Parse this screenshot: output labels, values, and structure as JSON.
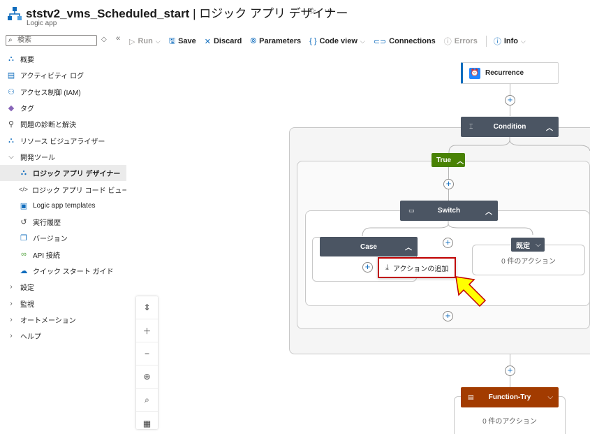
{
  "header": {
    "title": "ststv2_vms_Scheduled_start",
    "title_suffix": "| ロジック アプリ デザイナー",
    "subtitle": "Logic app",
    "star_icon": "☆",
    "more_icon": "···"
  },
  "toolbar": {
    "run": "Run",
    "save": "Save",
    "discard": "Discard",
    "parameters": "Parameters",
    "code_view": "Code view",
    "connections": "Connections",
    "errors": "Errors",
    "info": "Info"
  },
  "sidebar": {
    "search_placeholder": "検索",
    "items": [
      {
        "label": "概要",
        "icon": "overview-icon"
      },
      {
        "label": "アクティビティ ログ",
        "icon": "activity-log-icon"
      },
      {
        "label": "アクセス制御 (IAM)",
        "icon": "iam-icon"
      },
      {
        "label": "タグ",
        "icon": "tag-icon"
      },
      {
        "label": "問題の診断と解決",
        "icon": "wrench-icon"
      },
      {
        "label": "リソース ビジュアライザー",
        "icon": "visualizer-icon"
      },
      {
        "label": "開発ツール",
        "icon": "chevron-down-icon"
      },
      {
        "label": "ロジック アプリ デザイナー",
        "icon": "designer-icon"
      },
      {
        "label": "ロジック アプリ コード ビュー",
        "icon": "code-icon"
      },
      {
        "label": "Logic app templates",
        "icon": "templates-icon"
      },
      {
        "label": "実行履歴",
        "icon": "history-icon"
      },
      {
        "label": "バージョン",
        "icon": "versions-icon"
      },
      {
        "label": "API 接続",
        "icon": "api-connection-icon"
      },
      {
        "label": "クイック スタート ガイド",
        "icon": "quickstart-icon"
      },
      {
        "label": "設定",
        "icon": "chevron-right-icon"
      },
      {
        "label": "監視",
        "icon": "chevron-right-icon"
      },
      {
        "label": "オートメーション",
        "icon": "chevron-right-icon"
      },
      {
        "label": "ヘルプ",
        "icon": "chevron-right-icon"
      }
    ]
  },
  "canvas": {
    "recurrence": "Recurrence",
    "condition": "Condition",
    "true_label": "True",
    "switch": "Switch",
    "case": "Case",
    "default_label": "既定",
    "zero_actions": "0 件のアクション",
    "add_action": "アクションの追加",
    "function_try": "Function-Try",
    "zero_actions_bottom": "0 件のアクション"
  },
  "colors": {
    "accent": "#0f6cbd",
    "card_dark": "#4b5563",
    "true_green": "#498205",
    "function_orange": "#a23b00",
    "highlight_red": "#c00000",
    "arrow_yellow": "#ffff00"
  }
}
